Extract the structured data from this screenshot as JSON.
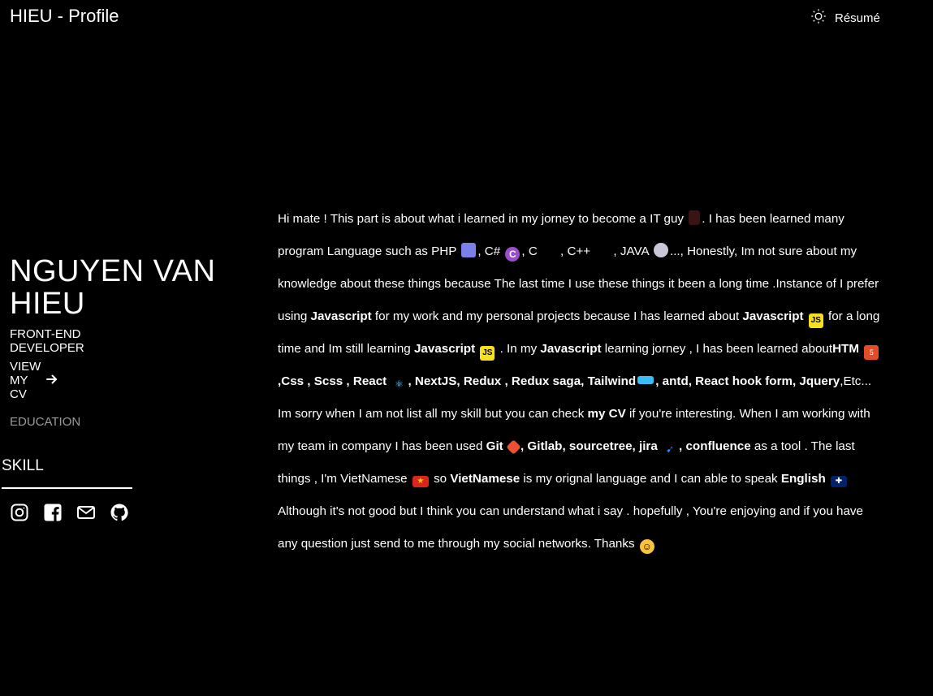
{
  "header": {
    "title": "HIEU - Profile",
    "resume_label": "Résumé",
    "resume_icon": "sun-icon"
  },
  "sidebar": {
    "name": "NGUYEN VAN HIEU",
    "role": "FRONT-END DEVELOPER",
    "view_cv": "VIEW MY CV",
    "nav": [
      {
        "label": "EDUCATION",
        "active": false
      },
      {
        "label": "SKILL",
        "active": true
      }
    ],
    "socials": [
      "instagram-icon",
      "facebook-icon",
      "mail-icon",
      "github-icon"
    ]
  },
  "content": {
    "segments": [
      {
        "t": "Hi mate ! This part is about what i learned in my jorney to become a IT guy "
      },
      {
        "e": "guy",
        "c": ""
      },
      {
        "t": ". I has been learned many program Language such as PHP "
      },
      {
        "e": "php",
        "c": ""
      },
      {
        "t": ", C# "
      },
      {
        "e": "cs",
        "c": "C"
      },
      {
        "t": ", C "
      },
      {
        "e": "blank",
        "c": ""
      },
      {
        "t": ", C++ "
      },
      {
        "e": "blank",
        "c": ""
      },
      {
        "t": ", JAVA "
      },
      {
        "e": "java",
        "c": ""
      },
      {
        "t": "..., Honestly, Im not sure about my knowledge about these things because The last time I use these things it been a long time .Instance of I prefer using "
      },
      {
        "b": "Javascript"
      },
      {
        "t": " for my work and my personal projects because I has learned about "
      },
      {
        "b": "Javascript"
      },
      {
        "t": " "
      },
      {
        "e": "js",
        "c": "JS"
      },
      {
        "t": "  for a long time and Im still learning "
      },
      {
        "b": "Javascript"
      },
      {
        "t": " "
      },
      {
        "e": "js",
        "c": "JS"
      },
      {
        "t": "  . In my "
      },
      {
        "b": "Javascript"
      },
      {
        "t": " learning jorney , I has been learned about"
      },
      {
        "b": "HTM"
      },
      {
        "t": " "
      },
      {
        "e": "html",
        "c": "5"
      },
      {
        "b": ",Css , Scss , React "
      },
      {
        "e": "react",
        "c": "⚛"
      },
      {
        "b": ", NextJS, Redux , Redux saga, Tailwind"
      },
      {
        "e": "tw",
        "c": ""
      },
      {
        "b": ", antd, React hook form, Jquery"
      },
      {
        "t": ",Etc... Im sorry when I am not list all my skill but you can check "
      },
      {
        "b": "my CV"
      },
      {
        "t": " if you're interesting. When I am working with my team in company I has been used "
      },
      {
        "b": "Git"
      },
      {
        "t": " "
      },
      {
        "e": "git",
        "c": ""
      },
      {
        "b": ", Gitlab, sourcetree, jira"
      },
      {
        "t": " "
      },
      {
        "e": "jira",
        "c": "➹"
      },
      {
        "b": ", confluence"
      },
      {
        "t": " as a tool . The last things , I'm VietNamese "
      },
      {
        "e": "vn",
        "c": "★"
      },
      {
        "t": " so "
      },
      {
        "b": "VietNamese"
      },
      {
        "t": " is my orignal language and I can able to speak "
      },
      {
        "b": "English"
      },
      {
        "t": " "
      },
      {
        "e": "uk",
        "c": "✚"
      },
      {
        "t": " Although it's not good but I think you can understand what i say . hopefully , You're enjoying and if you have any question just send to me through my social networks. Thanks "
      },
      {
        "e": "smile",
        "c": "☺"
      }
    ]
  }
}
